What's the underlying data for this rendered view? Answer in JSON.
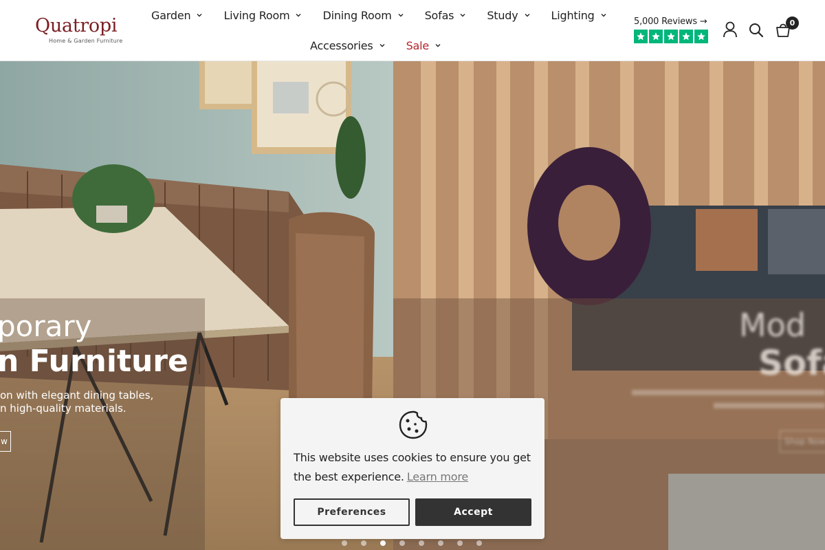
{
  "brand": {
    "name": "Quatropi",
    "tagline": "Home & Garden Furniture",
    "color": "#7a1f24"
  },
  "nav": {
    "row1": [
      {
        "label": "Garden"
      },
      {
        "label": "Living Room"
      },
      {
        "label": "Dining Room"
      },
      {
        "label": "Sofas"
      },
      {
        "label": "Study"
      },
      {
        "label": "Lighting"
      }
    ],
    "row2": [
      {
        "label": "Accessories"
      },
      {
        "label": "Sale"
      }
    ],
    "sale_color": "#b0262d"
  },
  "reviews": {
    "text": "5,000 Reviews",
    "arrow": "→",
    "stars": 5,
    "star_color": "#00b67a"
  },
  "header_icons": [
    "account-icon",
    "search-icon",
    "cart-icon"
  ],
  "cart": {
    "count": "0"
  },
  "hero": {
    "left_slide": {
      "title_line1": "porary",
      "title_line2": "n Furniture",
      "desc_line1": "on with elegant dining tables,",
      "desc_line2": "n high-quality materials.",
      "button": "w"
    },
    "right_slide": {
      "title_line1": "Mod",
      "title_line2": "Sofa",
      "button": "Shop Now"
    }
  },
  "slider": {
    "count": 8,
    "active": 3
  },
  "cookie": {
    "text": "This website uses cookies to ensure you get the best experience.",
    "link": "Learn more",
    "preferences": "Preferences",
    "accept": "Accept"
  }
}
